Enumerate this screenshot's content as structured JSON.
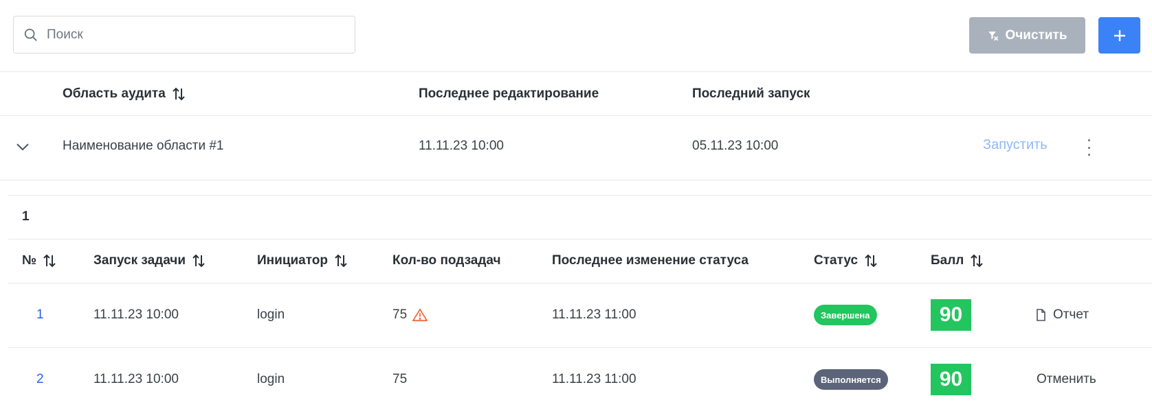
{
  "toolbar": {
    "search_placeholder": "Поиск",
    "search_value": "",
    "clear_label": "Очистить",
    "add_label": "+",
    "accent_color": "#3b82f6",
    "disabled_color": "#a9b1bd"
  },
  "outer_table": {
    "headers": {
      "area": "Область аудита",
      "last_edit": "Последнее редактирование",
      "last_run": "Последний запуск"
    },
    "row": {
      "name": "Наименование области #1",
      "last_edit": "11.11.23 10:00",
      "last_run": "05.11.23 10:00",
      "run_label": "Запустить",
      "expanded": true
    }
  },
  "inner": {
    "group_label": "1",
    "headers": {
      "num": "№",
      "task_run": "Запуск задачи",
      "initiator": "Инициатор",
      "subtasks": "Кол-во подзадач",
      "status_change": "Последнее изменение статуса",
      "status": "Статус",
      "score": "Балл"
    },
    "rows": [
      {
        "num": "1",
        "task_run": "11.11.23 10:00",
        "initiator": "login",
        "subtasks": "75",
        "warning": true,
        "status_change": "11.11.23 11:00",
        "status": "Завершена",
        "status_color": "#22c55e",
        "score": "90",
        "action": "Отчет"
      },
      {
        "num": "2",
        "task_run": "11.11.23 10:00",
        "initiator": "login",
        "subtasks": "75",
        "warning": false,
        "status_change": "11.11.23 11:00",
        "status": "Выполняется",
        "status_color": "#5b6478",
        "score": "90",
        "action": "Отменить"
      }
    ]
  }
}
